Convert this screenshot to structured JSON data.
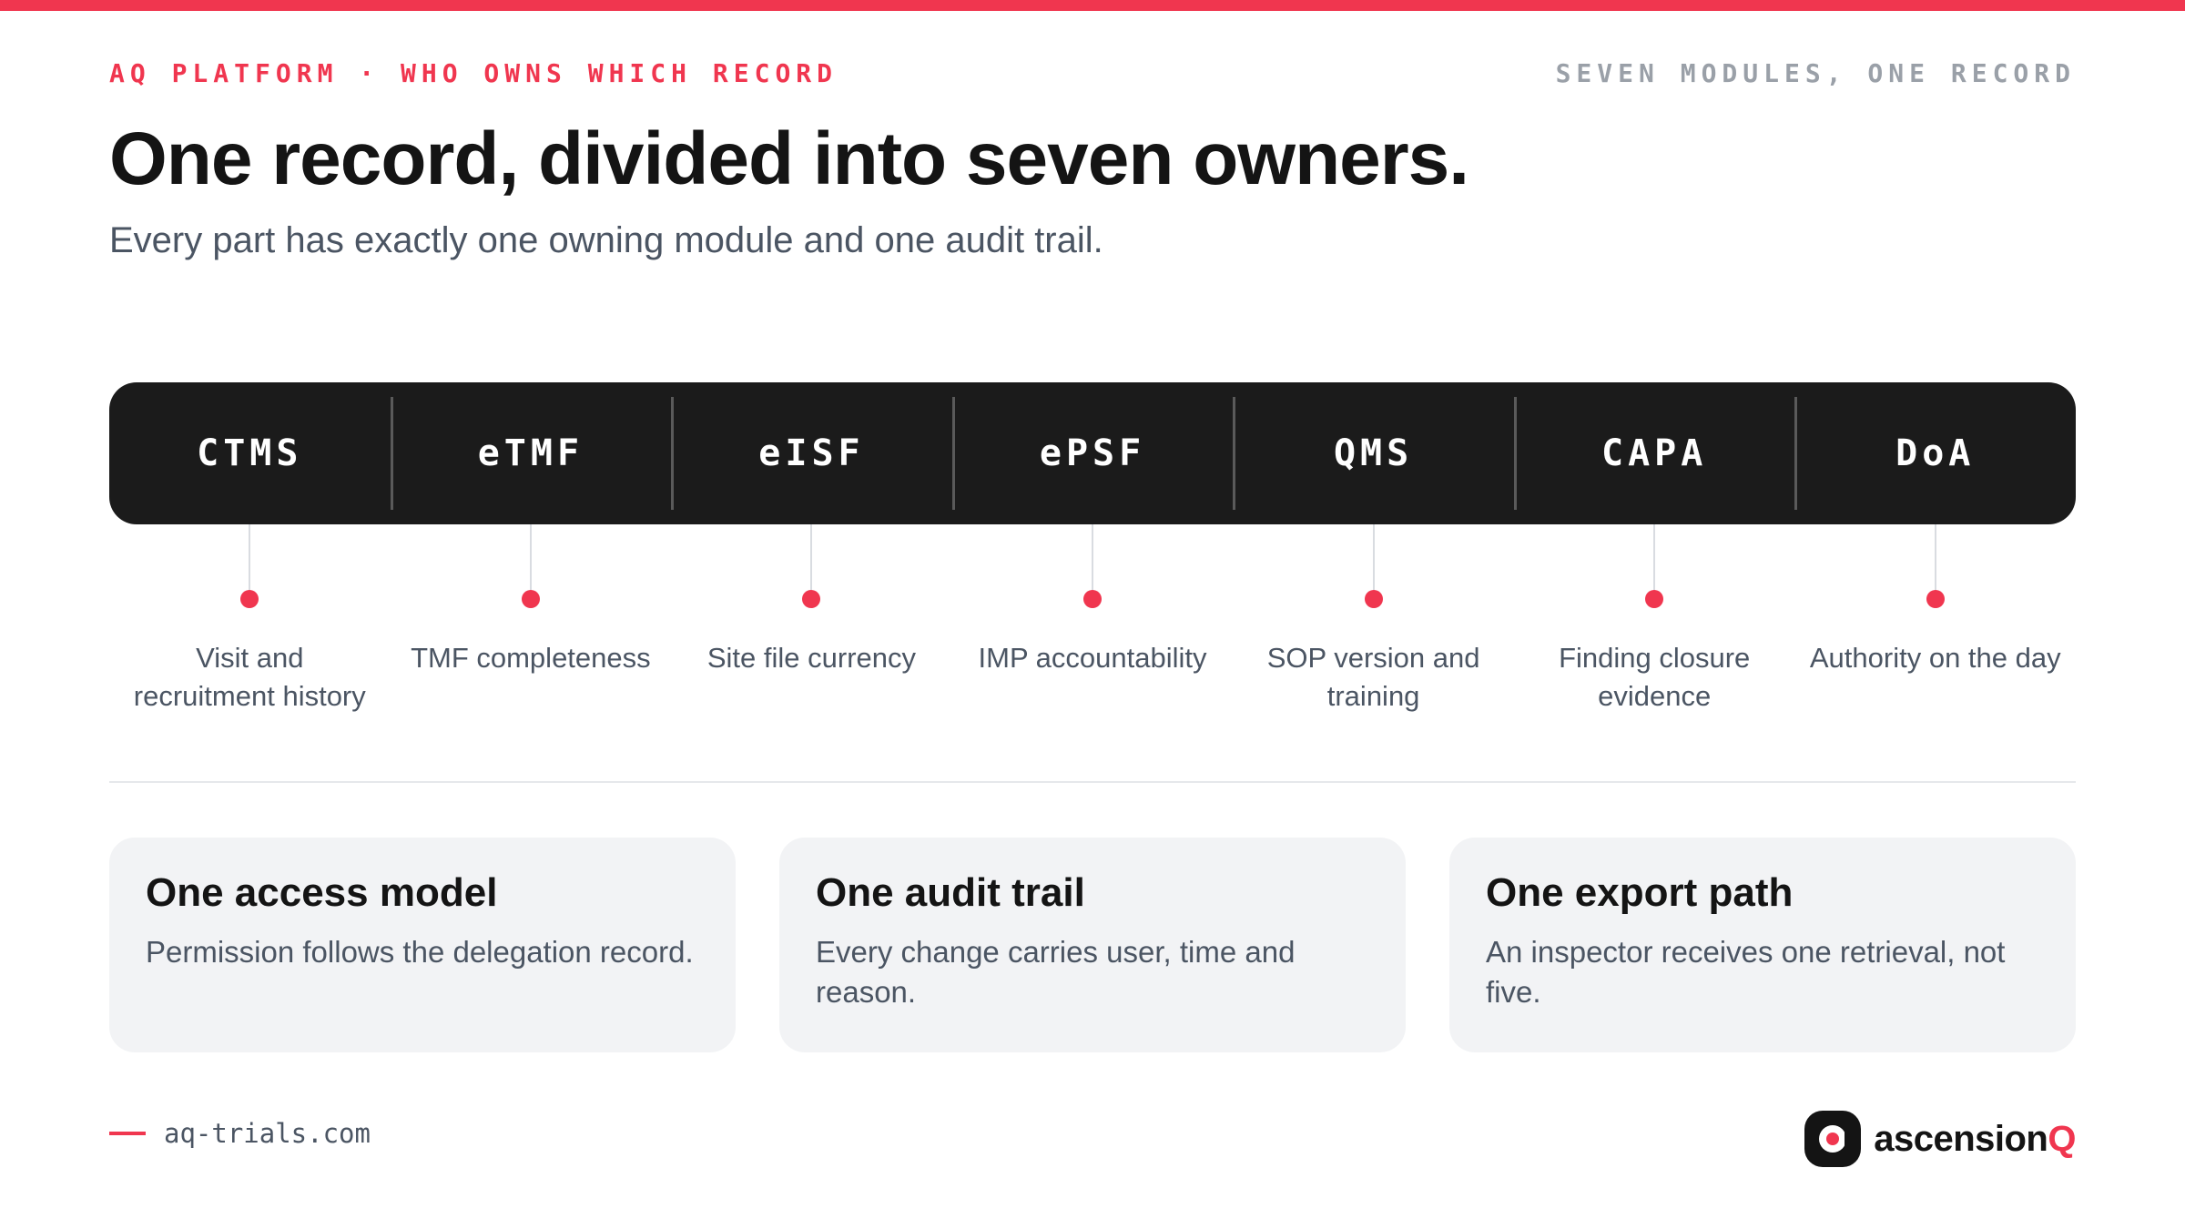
{
  "header": {
    "eyebrow": "AQ PLATFORM · WHO OWNS WHICH RECORD",
    "eyebrow_right": "SEVEN MODULES, ONE RECORD",
    "title": "One record, divided into seven owners.",
    "subtitle": "Every part has exactly one owning module and one audit trail."
  },
  "modules": [
    {
      "label": "CTMS",
      "owns": "Visit and recruitment history"
    },
    {
      "label": "eTMF",
      "owns": "TMF completeness"
    },
    {
      "label": "eISF",
      "owns": "Site file currency"
    },
    {
      "label": "ePSF",
      "owns": "IMP accountability"
    },
    {
      "label": "QMS",
      "owns": "SOP version and training"
    },
    {
      "label": "CAPA",
      "owns": "Finding closure evidence"
    },
    {
      "label": "DoA",
      "owns": "Authority on the day"
    }
  ],
  "cards": [
    {
      "title": "One access model",
      "body": "Permission follows the delegation record."
    },
    {
      "title": "One audit trail",
      "body": "Every change carries user, time and reason."
    },
    {
      "title": "One export path",
      "body": "An inspector receives one retrieval, not five."
    }
  ],
  "footer": {
    "url": "aq-trials.com",
    "logo_main": "ascension",
    "logo_accent": "Q"
  },
  "colors": {
    "accent": "#f0364f",
    "bar_background": "#1b1b1b",
    "card_background": "#f2f3f5"
  },
  "icons": {
    "logo": "ascensionq-logo-icon"
  }
}
